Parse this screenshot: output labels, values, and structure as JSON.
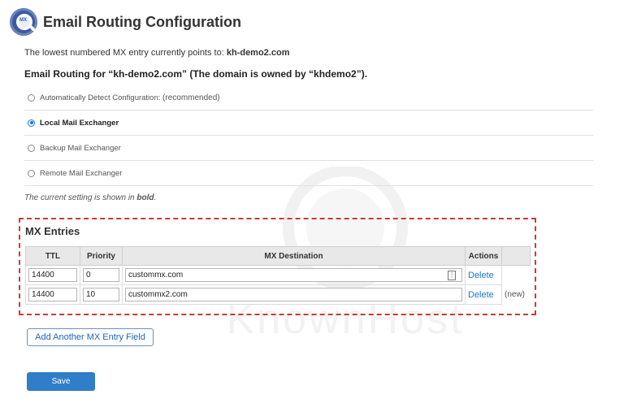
{
  "header": {
    "title": "Email Routing Configuration",
    "icon": "email-routing-icon",
    "icon_text": "MX"
  },
  "pointer": {
    "prefix": "The lowest numbered MX entry currently points to:",
    "domain": "kh-demo2.com"
  },
  "routing_heading": "Email Routing for “kh-demo2.com” (The domain is owned by “khdemo2”).",
  "options": [
    {
      "label": "Automatically Detect Configuration",
      "suffix": "(recommended)",
      "checked": false
    },
    {
      "label": "Local Mail Exchanger",
      "checked": true
    },
    {
      "label": "Backup Mail Exchanger",
      "checked": false
    },
    {
      "label": "Remote Mail Exchanger",
      "checked": false
    }
  ],
  "current_note": {
    "prefix": "The current setting is shown in",
    "bold_word": "bold",
    "suffix": "."
  },
  "mx": {
    "heading": "MX Entries",
    "columns": [
      "TTL",
      "Priority",
      "MX Destination",
      "Actions"
    ],
    "rows": [
      {
        "ttl": "14400",
        "priority": "0",
        "destination": "custommx.com",
        "action": "Delete",
        "tag": ""
      },
      {
        "ttl": "14400",
        "priority": "10",
        "destination": "custommx2.com",
        "action": "Delete",
        "tag": "(new)"
      }
    ]
  },
  "buttons": {
    "add": "Add Another MX Entry Field",
    "save": "Save"
  },
  "colors": {
    "accent": "#1b75d0",
    "highlight_border": "#d1353f",
    "save_bg": "#2f7ec7"
  }
}
